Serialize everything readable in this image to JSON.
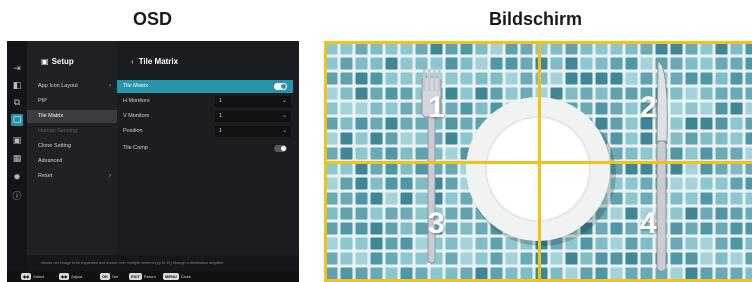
{
  "headings": {
    "osd": "OSD",
    "screen": "Bildschirm"
  },
  "iconbar": [
    {
      "name": "input-icon",
      "glyph": "⇥"
    },
    {
      "name": "picture-icon",
      "glyph": "◧"
    },
    {
      "name": "multi-picture-icon",
      "glyph": "⧉"
    },
    {
      "name": "display-icon",
      "glyph": "▢"
    },
    {
      "name": "setup-icon",
      "glyph": "▣"
    },
    {
      "name": "apps-icon",
      "glyph": "▦"
    },
    {
      "name": "gear-icon",
      "glyph": "✹"
    },
    {
      "name": "info-icon",
      "glyph": "ⓘ"
    }
  ],
  "col1": {
    "title": "Setup",
    "items": [
      {
        "label": "App Icon Layout",
        "chevron": "›"
      },
      {
        "label": "PIP",
        "chevron": ""
      },
      {
        "label": "Tile Matrix",
        "chevron": ""
      },
      {
        "label": "Human Sensing",
        "chevron": ""
      },
      {
        "label": "Clone Setting",
        "chevron": ""
      },
      {
        "label": "Advanced",
        "chevron": ""
      },
      {
        "label": "Reset",
        "chevron": "›"
      }
    ]
  },
  "col2": {
    "title": "Tile Matrix",
    "back": "‹",
    "rows": [
      {
        "label": "Tile Matrix",
        "type": "toggle",
        "state": "on"
      },
      {
        "label": "H Monitors",
        "type": "select",
        "value": "1"
      },
      {
        "label": "V Monitors",
        "type": "select",
        "value": "1"
      },
      {
        "label": "Position",
        "type": "select",
        "value": "1"
      },
      {
        "label": "Tile Comp",
        "type": "toggle",
        "state": "off"
      }
    ]
  },
  "help": "Allows one image to be expanded and shown over multiple screens (up to 10) through a distribution amplifier.",
  "footer": [
    {
      "key": "◆◆",
      "label": "Select"
    },
    {
      "key": "◆◆",
      "label": "Adjust"
    },
    {
      "key": "OK",
      "label": "Set"
    },
    {
      "key": "EXIT",
      "label": "Return"
    },
    {
      "key": "MENU",
      "label": "Close"
    }
  ],
  "quadrants": [
    "1",
    "2",
    "3",
    "4"
  ],
  "colors": {
    "accent": "#2a94ad",
    "grid": "#f0c31a"
  }
}
